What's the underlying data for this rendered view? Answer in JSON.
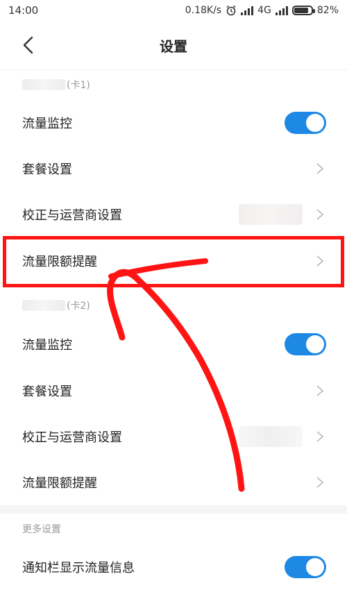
{
  "status_bar": {
    "time": "14:00",
    "speed": "0.18K/s",
    "network": "4G",
    "battery": "82%",
    "battery_level": 0.82
  },
  "header": {
    "title": "设置"
  },
  "sim1": {
    "section_label": "(卡1)",
    "rows": [
      {
        "label": "流量监控",
        "type": "toggle",
        "on": true
      },
      {
        "label": "套餐设置",
        "type": "chevron"
      },
      {
        "label": "校正与运营商设置",
        "type": "chevron"
      },
      {
        "label": "流量限额提醒",
        "type": "chevron"
      }
    ]
  },
  "sim2": {
    "section_label": "(卡2)",
    "rows": [
      {
        "label": "流量监控",
        "type": "toggle",
        "on": true
      },
      {
        "label": "套餐设置",
        "type": "chevron"
      },
      {
        "label": "校正与运营商设置",
        "type": "chevron"
      },
      {
        "label": "流量限额提醒",
        "type": "chevron"
      }
    ]
  },
  "more": {
    "section_label": "更多设置",
    "rows": [
      {
        "label": "通知栏显示流量信息",
        "type": "toggle",
        "on": true
      }
    ]
  },
  "colors": {
    "accent": "#1e88e5",
    "annotation": "#ff1414"
  },
  "icons": {
    "back": "chevron-left-icon",
    "row_arrow": "chevron-right-icon"
  }
}
